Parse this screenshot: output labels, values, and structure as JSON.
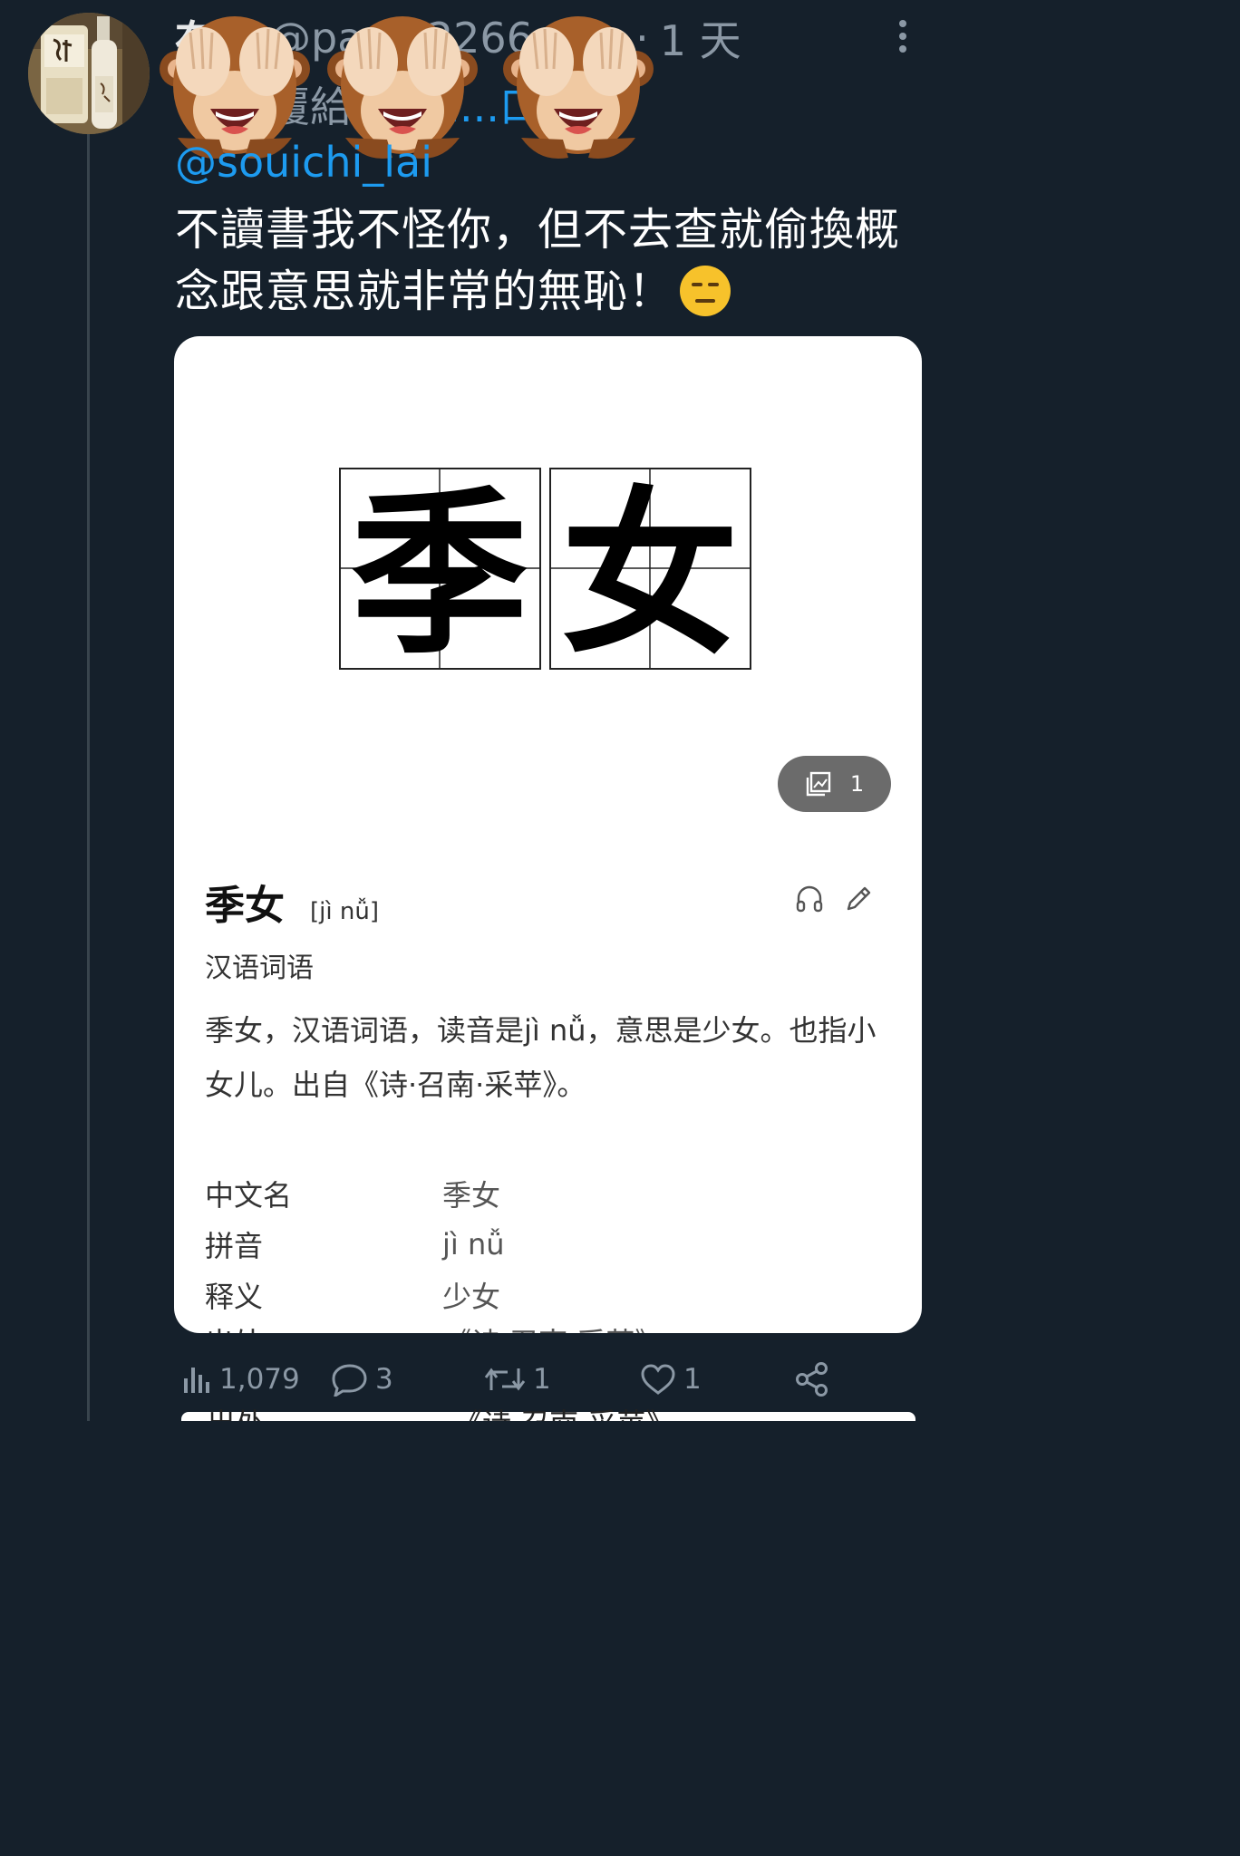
{
  "reply": {
    "display_name": "存玉",
    "handle": "@pa...k2266...an",
    "time": "1 天",
    "reply_prefix": "回覆給",
    "reply_to": "@gu...口",
    "mention": "@souichi_lai",
    "text": "不讀書我不怪你，但不去查就偷換概念跟意思就非常的無恥！",
    "emoji_end": "expressionless-face-emoji",
    "censor_emoji": "see-no-evil-monkey-emoji"
  },
  "card": {
    "headline_chars": [
      "季",
      "女"
    ],
    "gallery_count": "1",
    "term": "季女",
    "pinyin": "[jì nǚ]",
    "category": "汉语词语",
    "description": "季女，汉语词语，读音是jì nǚ，意思是少女。也指小女儿。出自《诗·召南·采苹》。",
    "info": [
      {
        "label": "中文名",
        "value": "季女"
      },
      {
        "label": "拼音",
        "value": "jì nǚ"
      },
      {
        "label": "释义",
        "value": "少女"
      },
      {
        "label": "出处",
        "value": "《诗·召南·采苹》"
      }
    ]
  },
  "actions": {
    "views": "1,079",
    "replies": "3",
    "retweets": "1",
    "likes": "1"
  },
  "next_row": {
    "label": "出处",
    "value": "《诗·召南·采苹》"
  },
  "colors": {
    "background": "#15202b",
    "link": "#1d9bf0",
    "muted": "#8b98a5",
    "text": "#e7e9ea"
  }
}
